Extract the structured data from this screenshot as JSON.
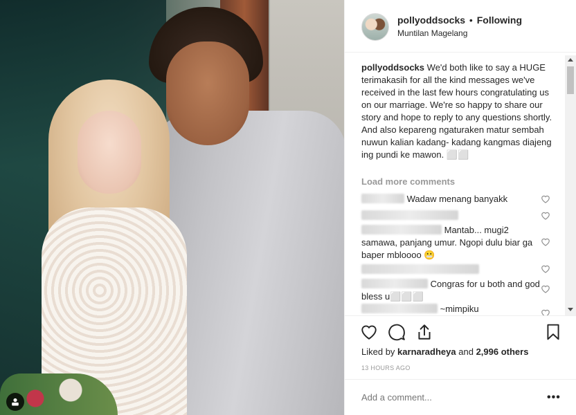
{
  "post": {
    "username": "pollyoddsocks",
    "follow_status": "Following",
    "separator": "•",
    "location": "Muntilan Magelang"
  },
  "caption": {
    "username": "pollyoddsocks",
    "text": "We'd both like to say a HUGE terimakasih for all the kind messages we've received in the last few hours congratulating us on our marriage. We're so happy to share our story and hope to reply to any questions shortly.",
    "text2": "And also kepareng ngaturaken matur sembah nuwun kalian kadang- kadang kangmas diajeng ing pundi ke mawon. ⬜⬜"
  },
  "load_more": "Load more comments",
  "comments": [
    {
      "text": "Wadaw menang banyakk"
    },
    {
      "text": ""
    },
    {
      "text": "Mantab... mugi2 samawa, panjang umur. Ngopi dulu biar ga baper mbloooo 😬"
    },
    {
      "text": ""
    },
    {
      "text": "Congras for u both and god bless u⬜⬜⬜"
    },
    {
      "text": "~mimpiku"
    }
  ],
  "likes": {
    "prefix": "Liked by",
    "user": "karnaradheya",
    "conj": "and",
    "others": "2,996 others"
  },
  "timestamp": "13 HOURS AGO",
  "add_comment": {
    "placeholder": "Add a comment..."
  },
  "more_label": "•••",
  "icons": {
    "heart": "heart-icon",
    "comment": "comment-icon",
    "share": "share-icon",
    "save": "bookmark-icon",
    "user_tag": "user-tag-icon"
  }
}
